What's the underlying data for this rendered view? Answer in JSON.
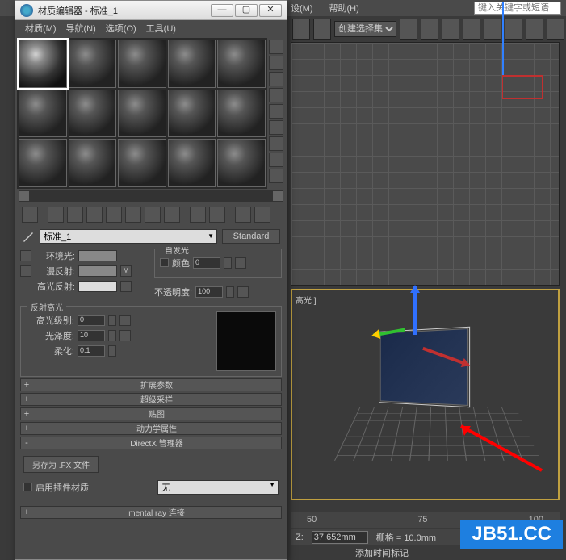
{
  "main_menu": {
    "set": "设(M)",
    "help": "帮助(H)"
  },
  "keyframe_placeholder": "键入关键字或短语",
  "selection_set": "创建选择集",
  "viewport_persp_label": "高光 ]",
  "ruler": [
    "50",
    "75",
    "100"
  ],
  "status": {
    "z_label": "Z:",
    "z_value": "37.652mm",
    "grid_label": "栅格 = 10.0mm"
  },
  "time_tag": "添加时间标记",
  "watermark": "JB51.CC",
  "dialog": {
    "title": "材质编辑器 - 标准_1",
    "menu": {
      "material": "材质(M)",
      "navigate": "导航(N)",
      "options": "选项(O)",
      "tools": "工具(U)"
    },
    "material_name": "标准_1",
    "type_button": "Standard",
    "group_selfillum": "自发光",
    "color_check_label": "颜色",
    "color_value": "0",
    "ambient_label": "环境光:",
    "diffuse_label": "漫反射:",
    "specular_label": "高光反射:",
    "opacity_label": "不透明度:",
    "opacity_value": "100",
    "refl_group": "反射高光",
    "spec_level_label": "高光级别:",
    "spec_level_value": "0",
    "gloss_label": "光泽度:",
    "gloss_value": "10",
    "soften_label": "柔化:",
    "soften_value": "0.1",
    "rollouts": {
      "extended": "扩展参数",
      "supersample": "超级采样",
      "maps": "贴图",
      "dynamics": "动力学属性",
      "directx": "DirectX 管理器"
    },
    "save_fx": "另存为 .FX 文件",
    "plugin_check": "启用插件材质",
    "plugin_value": "无",
    "mental_ray": "mental ray 连接"
  }
}
